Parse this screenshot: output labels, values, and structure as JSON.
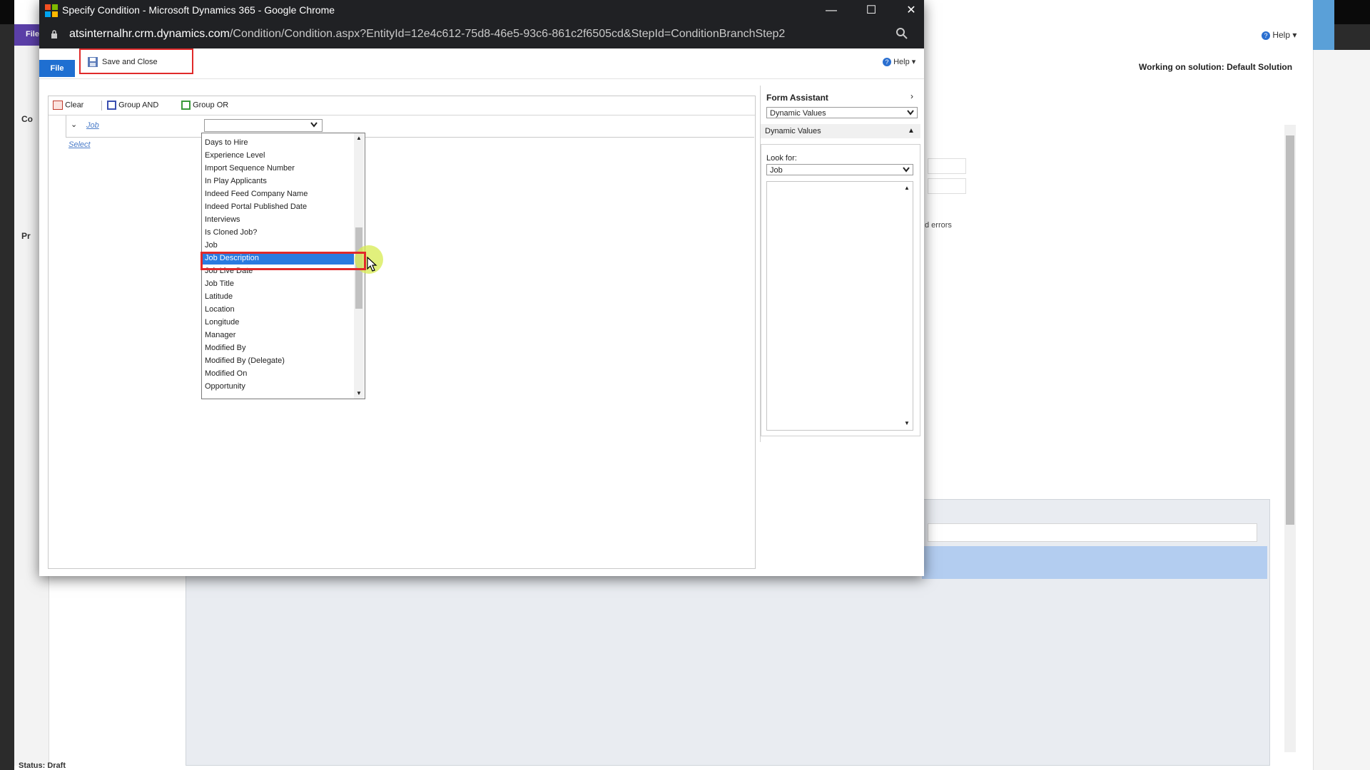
{
  "background": {
    "file_tab": "File",
    "help": "Help",
    "solution": "Working on solution: Default Solution",
    "nav_label_1": "Co",
    "nav_label_2": "Pr",
    "errors_text": "d errors",
    "status": "Status: Draft"
  },
  "window": {
    "title": "Specify Condition - Microsoft Dynamics 365 - Google Chrome",
    "url_host": "atsinternalhr.crm.dynamics.com",
    "url_path": "/Condition/Condition.aspx?EntityId=12e4c612-75d8-46e5-93c6-861c2f6505cd&StepId=ConditionBranchStep2",
    "minimize": "—",
    "maximize": "☐",
    "close": "✕"
  },
  "ribbon": {
    "file_label": "File",
    "save_close_label": "Save and Close",
    "help_label": "Help"
  },
  "condition": {
    "toolbar": {
      "clear": "Clear",
      "group_and": "Group AND",
      "group_or": "Group OR"
    },
    "entity_link": "Job",
    "select_link": "Select"
  },
  "dropdown": {
    "items": [
      "Days to Hire",
      "Experience Level",
      "Import Sequence Number",
      "In Play Applicants",
      "Indeed Feed Company Name",
      "Indeed Portal Published Date",
      "Interviews",
      "Is Cloned Job?",
      "Job",
      "Job Description",
      "Job Live Date",
      "Job Title",
      "Latitude",
      "Location",
      "Longitude",
      "Manager",
      "Modified By",
      "Modified By (Delegate)",
      "Modified On",
      "Opportunity"
    ],
    "selected": "Job Description"
  },
  "form_assistant": {
    "title": "Form Assistant",
    "select_value": "Dynamic Values",
    "section": "Dynamic Values",
    "look_for_label": "Look for:",
    "look_for_value": "Job"
  },
  "colors": {
    "accent": "#1f6fd1",
    "highlight_border": "#e02a2a",
    "selected_item": "#2a7be0"
  }
}
